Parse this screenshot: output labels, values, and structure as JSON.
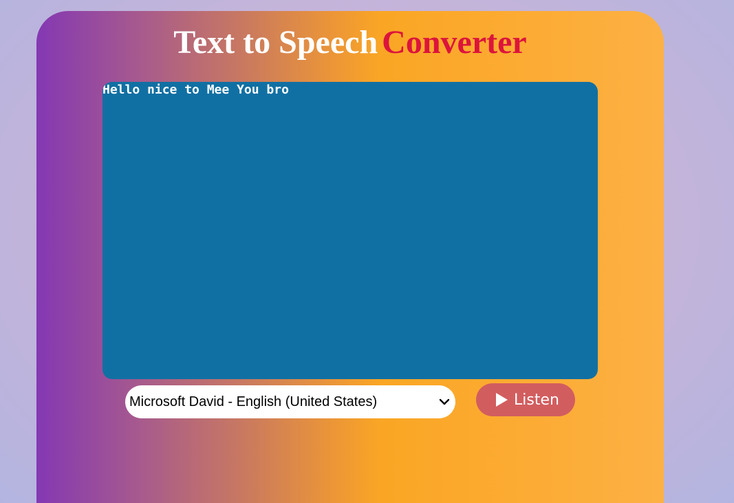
{
  "header": {
    "title_part1": "Text to Speech",
    "title_part2": "Converter"
  },
  "editor": {
    "value": "Hello nice to Mee You bro"
  },
  "voice_select": {
    "selected": "Microsoft David - English (United States)",
    "icon": "chevron-down-icon"
  },
  "listen_button": {
    "label": "Listen",
    "icon": "play-icon"
  },
  "colors": {
    "title_accent": "#dc143c",
    "editor_bg": "#1170a3",
    "button_bg": "#d25d5f"
  }
}
